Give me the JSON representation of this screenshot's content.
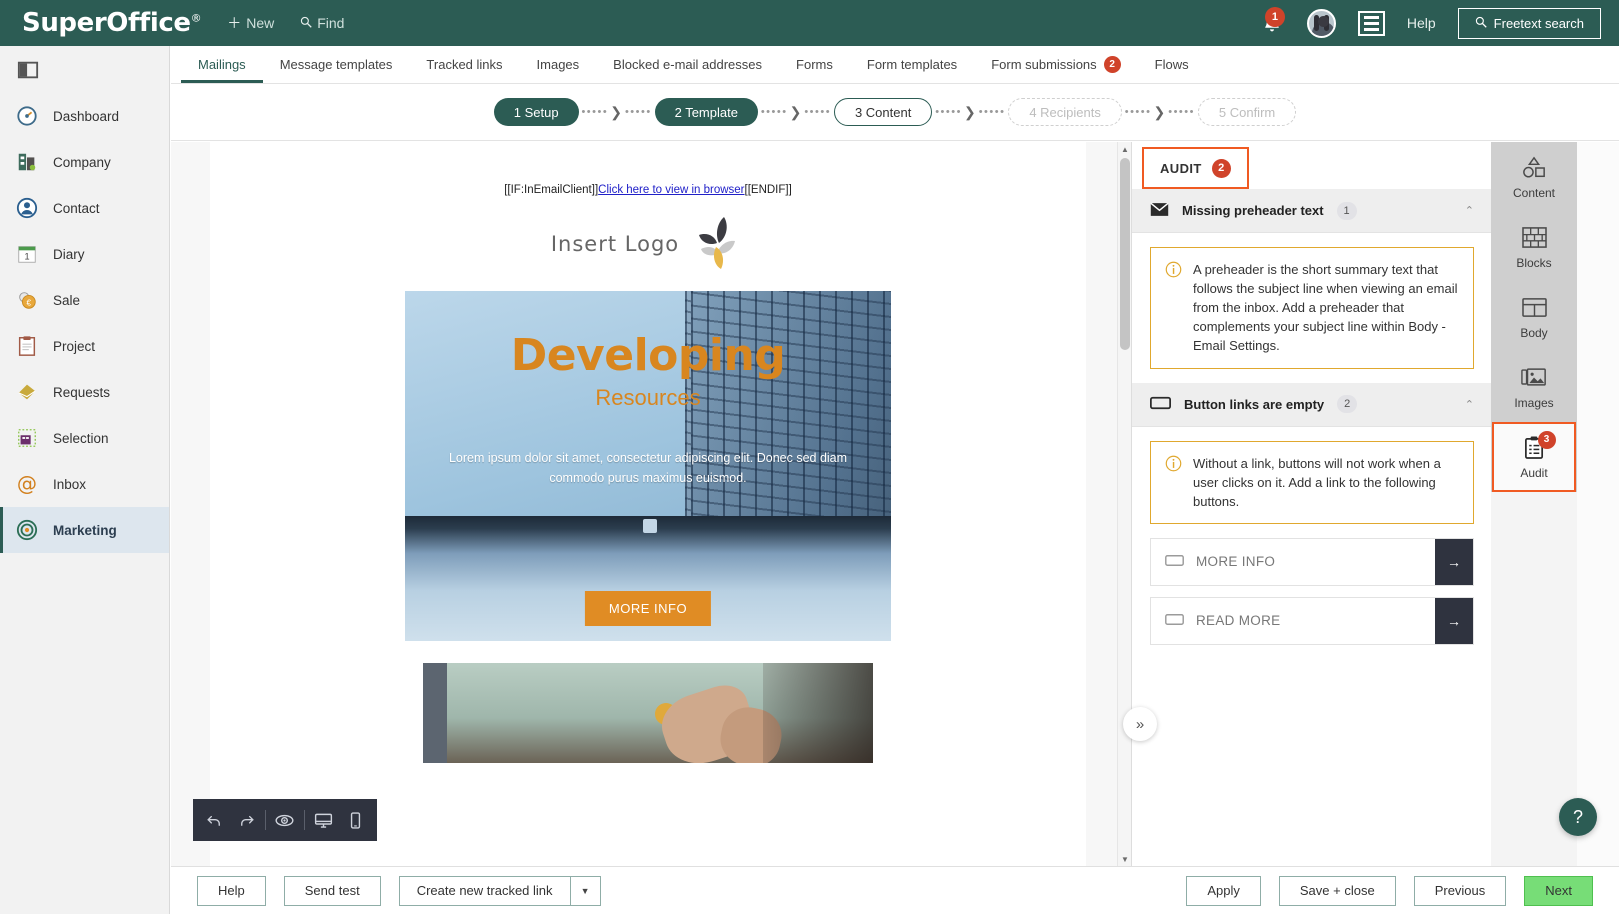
{
  "header": {
    "brand": "SuperOffice",
    "brand_mark": "®",
    "new_label": "New",
    "new_icon": "plus-icon",
    "find_label": "Find",
    "find_icon": "search-icon",
    "notification_count": "1",
    "notification_icon": "bell-icon",
    "avatar_icon": "user-avatar",
    "menu_icon": "hamburger-menu-icon",
    "help_label": "Help",
    "freetext_label": "Freetext search",
    "freetext_icon": "search-icon",
    "bg_color": "#2c5c54"
  },
  "sidebar": {
    "toggle_icon": "panel-toggle-icon",
    "items": [
      {
        "label": "Dashboard",
        "icon": "gauge-icon"
      },
      {
        "label": "Company",
        "icon": "building-icon"
      },
      {
        "label": "Contact",
        "icon": "person-icon"
      },
      {
        "label": "Diary",
        "icon": "calendar-icon"
      },
      {
        "label": "Sale",
        "icon": "coin-icon"
      },
      {
        "label": "Project",
        "icon": "clipboard-icon"
      },
      {
        "label": "Requests",
        "icon": "envelope-diamond-icon"
      },
      {
        "label": "Selection",
        "icon": "selection-grid-icon"
      },
      {
        "label": "Inbox",
        "icon": "at-sign-icon"
      },
      {
        "label": "Marketing",
        "icon": "target-icon",
        "active": true
      }
    ]
  },
  "tabs": [
    {
      "label": "Mailings",
      "active": true
    },
    {
      "label": "Message templates"
    },
    {
      "label": "Tracked links"
    },
    {
      "label": "Images"
    },
    {
      "label": "Blocked e-mail addresses"
    },
    {
      "label": "Forms"
    },
    {
      "label": "Form templates"
    },
    {
      "label": "Form submissions",
      "badge": "2"
    },
    {
      "label": "Flows"
    }
  ],
  "stepper": {
    "steps": [
      {
        "label": "1 Setup",
        "state": "done"
      },
      {
        "label": "2 Template",
        "state": "done"
      },
      {
        "label": "3 Content",
        "state": "current"
      },
      {
        "label": "4 Recipients",
        "state": "todo"
      },
      {
        "label": "5 Confirm",
        "state": "todo"
      }
    ],
    "connector_dots": "•••••",
    "connector_arrow": "❯"
  },
  "email_preview": {
    "browser_prefix": "[[IF:InEmailClient]]",
    "browser_link": "Click here to view in browser",
    "browser_suffix": "[[ENDIF]]",
    "logo_text": "Insert Logo",
    "hero_title": "Developing",
    "hero_subtitle": "Resources",
    "hero_body": "Lorem ipsum dolor sit amet, consectetur adipiscing elit. Donec sed diam commodo purus maximus euismod.",
    "hero_button": "MORE INFO"
  },
  "editor_toolbar": {
    "undo_icon": "undo-icon",
    "redo_icon": "redo-icon",
    "preview_icon": "eye-icon",
    "desktop_icon": "desktop-icon",
    "mobile_icon": "mobile-icon"
  },
  "collapse_button": {
    "icon": "chevron-double-right-icon",
    "glyph": "»"
  },
  "audit": {
    "title": "AUDIT",
    "badge": "2",
    "highlight_color": "#f05a22",
    "sections": [
      {
        "title": "Missing preheader text",
        "icon": "envelope-icon",
        "count": "1",
        "chevron": "⌃",
        "info_icon": "info-circle-icon",
        "info_text": "A preheader is the short summary text that follows the subject line when viewing an email from the inbox. Add a preheader that complements your subject line within Body - Email Settings."
      },
      {
        "title": "Button links are empty",
        "icon": "button-icon",
        "count": "2",
        "chevron": "⌃",
        "info_icon": "info-circle-icon",
        "info_text": "Without a link, buttons will not work when a user clicks on it. Add a link to the following buttons.",
        "items": [
          {
            "label": "MORE INFO",
            "icon": "button-icon",
            "action_icon": "arrow-right-icon",
            "action_glyph": "→"
          },
          {
            "label": "READ MORE",
            "icon": "button-icon",
            "action_icon": "arrow-right-icon",
            "action_glyph": "→"
          }
        ]
      }
    ]
  },
  "rail": {
    "items": [
      {
        "label": "Content",
        "icon": "shapes-icon"
      },
      {
        "label": "Blocks",
        "icon": "brick-wall-icon"
      },
      {
        "label": "Body",
        "icon": "layout-icon"
      },
      {
        "label": "Images",
        "icon": "image-icon"
      },
      {
        "label": "Audit",
        "icon": "audit-clipboard-icon",
        "badge": "3",
        "selected": true
      }
    ]
  },
  "footer": {
    "help": "Help",
    "send_test": "Send test",
    "create_tracked_link": "Create new tracked link",
    "create_tracked_link_caret": "▼",
    "apply": "Apply",
    "save_close": "Save + close",
    "previous": "Previous",
    "next": "Next",
    "next_color": "#77dd77"
  },
  "help_fab": {
    "label": "?",
    "icon": "question-mark-icon"
  }
}
